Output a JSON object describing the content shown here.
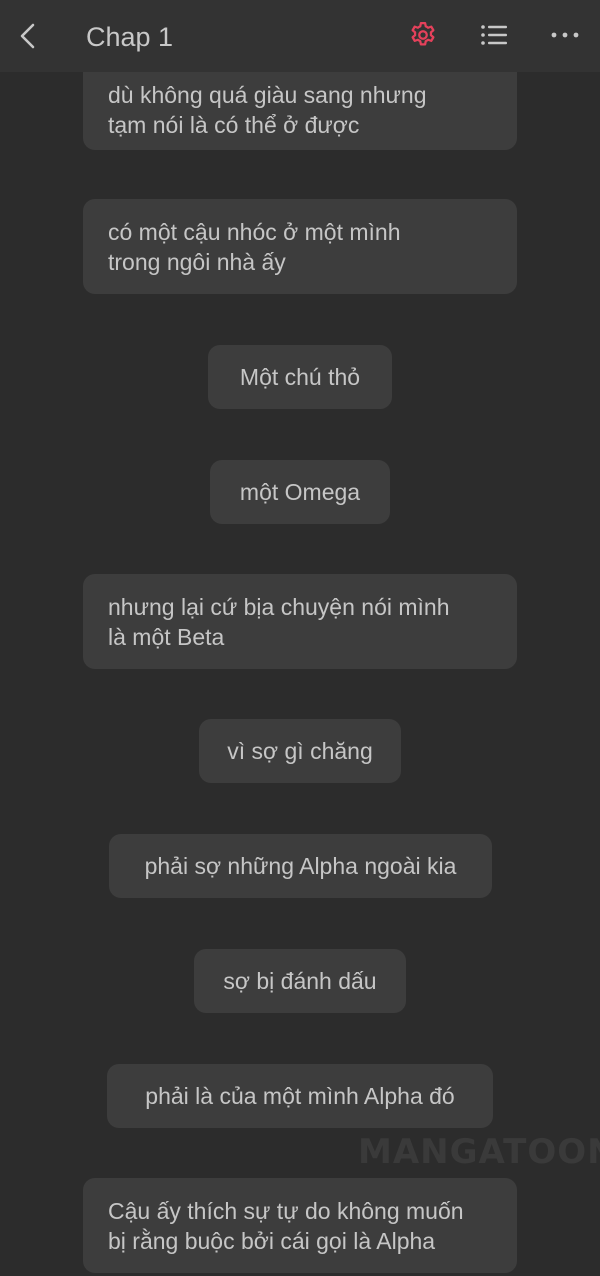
{
  "header": {
    "title": "Chap 1",
    "icons": {
      "back": "chevron-left-icon",
      "settings": "gear-icon",
      "chapters": "list-icon",
      "more": "more-icon"
    },
    "accent_color": "#e5415b"
  },
  "messages": [
    "dù không quá giàu sang nhưng\ntạm nói là có thể ở được",
    "có một cậu nhóc ở một mình\ntrong ngôi nhà ấy",
    "Một chú thỏ",
    "một Omega",
    "nhưng lại cứ bịa chuyện nói mình\nlà một Beta",
    "vì sợ gì chăng",
    "phải sợ những Alpha ngoài kia",
    "sợ bị đánh dấu",
    "phải là của một mình Alpha đó",
    "Cậu ấy thích sự tự do không muốn\nbị rằng buộc bởi cái gọi là Alpha"
  ],
  "watermark": "MANGATOON"
}
